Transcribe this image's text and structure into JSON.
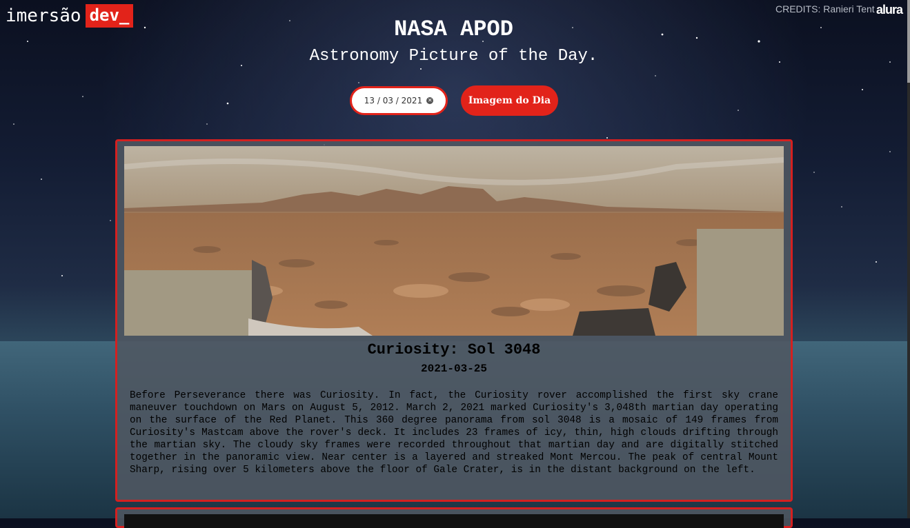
{
  "brand": {
    "logo_text": "imersão",
    "logo_badge": "dev_",
    "credits": "CREDITS: Ranieri Tent",
    "partner": "alura"
  },
  "header": {
    "title": "NASA APOD",
    "subtitle": "Astronomy Picture of the Day."
  },
  "controls": {
    "date_value": "13 / 03 / 2021",
    "button_label": "Imagem do Dia"
  },
  "colors": {
    "accent": "#e2231a",
    "card_bg": "#50585f"
  },
  "icons": {
    "clear": "clear-icon"
  },
  "apod": {
    "image_alt": "Curiosity Mars panorama",
    "title": "Curiosity: Sol 3048",
    "date": "2021-03-25",
    "explanation": "Before Perseverance there was Curiosity. In fact, the Curiosity rover accomplished the first sky crane maneuver touchdown on Mars on August 5, 2012. March 2, 2021 marked Curiosity's 3,048th martian day operating on the surface of the Red Planet. This 360 degree panorama from sol 3048 is a mosaic of 149 frames from Curiosity's Mastcam above the rover's deck. It includes 23 frames of icy, thin, high clouds drifting through the martian sky. The cloudy sky frames were recorded throughout that martian day and are digitally stitched together in the panoramic view. Near center is a layered and streaked Mont Mercou. The peak of central Mount Sharp, rising over 5 kilometers above the floor of Gale Crater, is in the distant background on the left."
  }
}
